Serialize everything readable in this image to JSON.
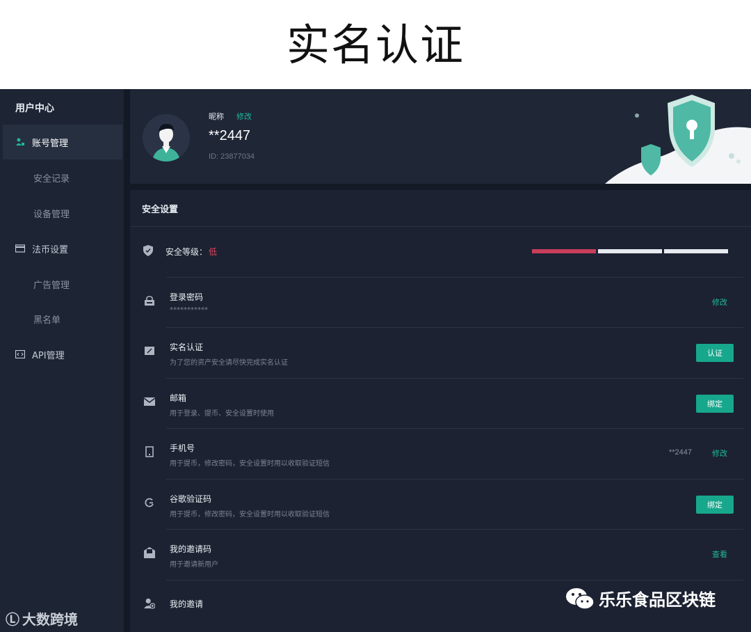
{
  "banner": {
    "title": "实名认证"
  },
  "sidebar": {
    "title": "用户中心",
    "items": [
      {
        "label": "账号管理",
        "icon": "user-group-icon",
        "active": true
      },
      {
        "label": "安全记录"
      },
      {
        "label": "设备管理"
      },
      {
        "label": "法币设置",
        "icon": "card-icon"
      },
      {
        "label": "广告管理"
      },
      {
        "label": "黑名单"
      },
      {
        "label": "API管理",
        "icon": "code-icon"
      }
    ]
  },
  "profile": {
    "nickname_label": "昵称",
    "edit_label": "修改",
    "nickname": "**2447",
    "uid": "ID: 23877034"
  },
  "security": {
    "title": "安全设置",
    "level_label": "安全等级：",
    "level_value": "低",
    "level_segments": 3,
    "level_filled": 1,
    "rows": [
      {
        "title": "登录密码",
        "desc": "***********",
        "action": "修改",
        "action_type": "link",
        "icon": "lock-icon"
      },
      {
        "title": "实名认证",
        "desc": "为了您的资产安全请尽快完成实名认证",
        "action": "认证",
        "action_type": "button",
        "icon": "id-card-icon"
      },
      {
        "title": "邮箱",
        "desc": "用于登录、提币、安全设置时使用",
        "action": "绑定",
        "action_type": "button",
        "icon": "mail-icon"
      },
      {
        "title": "手机号",
        "desc": "用于提币，修改密码，安全设置时用以收取验证短信",
        "extra": "**2447",
        "action": "修改",
        "action_type": "link",
        "icon": "phone-icon"
      },
      {
        "title": "谷歌验证码",
        "desc": "用于提币，修改密码，安全设置时用以收取验证短信",
        "action": "绑定",
        "action_type": "button",
        "icon": "google-auth-icon"
      },
      {
        "title": "我的邀请码",
        "desc": "用于邀请新用户",
        "action": "查看",
        "action_type": "link",
        "icon": "invite-code-icon"
      },
      {
        "title": "我的邀请",
        "desc": "",
        "action": "",
        "action_type": "none",
        "icon": "add-user-icon"
      }
    ]
  },
  "watermarks": {
    "left": "大数跨境",
    "left_logo": "Ⓛ",
    "right": "乐乐食品区块链"
  },
  "colors": {
    "accent": "#17a78c",
    "danger": "#c83e5b",
    "background": "#141a25",
    "panel": "#1c2232"
  }
}
